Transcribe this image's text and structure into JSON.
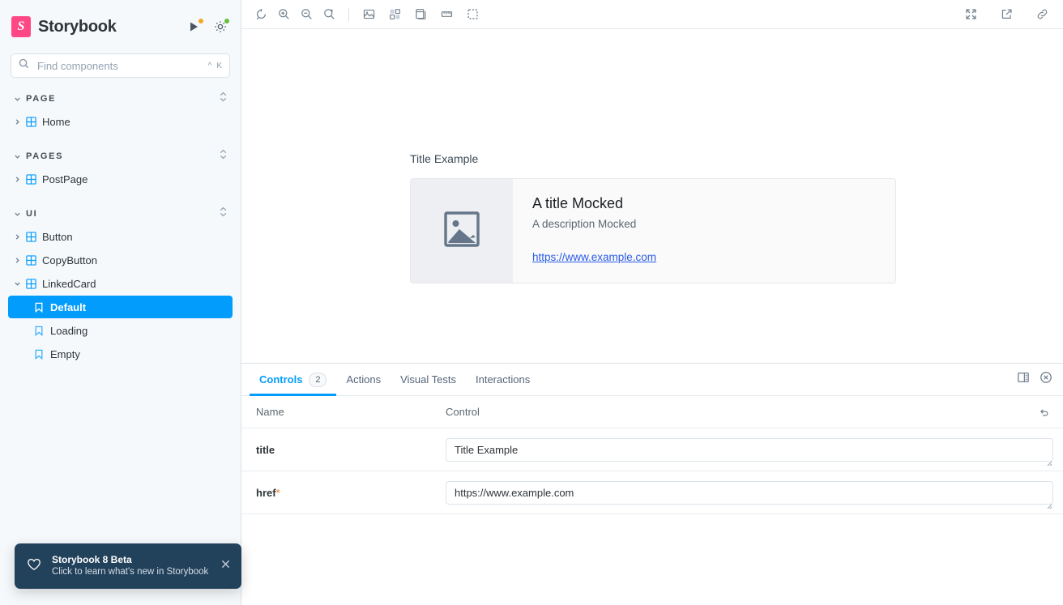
{
  "sidebar": {
    "brand": "Storybook",
    "logo_glyph": "S",
    "brand_color": "#FF4785",
    "header_icons": [
      {
        "name": "whats-new-icon",
        "dot": "orange"
      },
      {
        "name": "settings-gear-icon",
        "dot": "green"
      }
    ],
    "search": {
      "placeholder": "Find components",
      "value": "",
      "shortcut_modifier": "^",
      "shortcut_key": "K"
    },
    "sections": [
      {
        "title": "PAGE",
        "items": [
          {
            "label": "Home",
            "type": "component",
            "expanded": false,
            "selected": false
          }
        ]
      },
      {
        "title": "PAGES",
        "items": [
          {
            "label": "PostPage",
            "type": "component",
            "expanded": false,
            "selected": false
          }
        ]
      },
      {
        "title": "UI",
        "items": [
          {
            "label": "Button",
            "type": "component",
            "expanded": false,
            "selected": false
          },
          {
            "label": "CopyButton",
            "type": "component",
            "expanded": false,
            "selected": false
          },
          {
            "label": "LinkedCard",
            "type": "component",
            "expanded": true,
            "selected": false
          },
          {
            "label": "Default",
            "type": "story",
            "selected": true
          },
          {
            "label": "Loading",
            "type": "story",
            "selected": false
          },
          {
            "label": "Empty",
            "type": "story",
            "selected": false
          }
        ]
      }
    ],
    "toast": {
      "title": "Storybook 8 Beta",
      "subtitle": "Click to learn what's new in Storybook",
      "background": "#22415B",
      "icon": "heart-icon",
      "close_icon": "close-icon"
    }
  },
  "toolbar": {
    "left_icons": [
      "remount-icon",
      "zoom-in-icon",
      "zoom-out-icon",
      "zoom-reset-icon"
    ],
    "group_icons": [
      "backgrounds-icon",
      "grid-icon",
      "theme-icon",
      "measure-icon",
      "outline-icon"
    ],
    "right_icons": [
      "fullscreen-icon",
      "open-new-tab-icon",
      "copy-link-icon"
    ]
  },
  "preview": {
    "story_title": "Title Example",
    "card": {
      "title": "A title Mocked",
      "description": "A description Mocked",
      "link": "https://www.example.com",
      "link_color": "#2B5CE6",
      "image_placeholder_icon": "image-placeholder-icon"
    }
  },
  "panel": {
    "tabs": [
      {
        "label": "Controls",
        "badge": "2",
        "active": true
      },
      {
        "label": "Actions",
        "badge": null,
        "active": false
      },
      {
        "label": "Visual Tests",
        "badge": null,
        "active": false
      },
      {
        "label": "Interactions",
        "badge": null,
        "active": false
      }
    ],
    "active_color": "#029CFD",
    "actions": [
      {
        "name": "panel-position-icon"
      },
      {
        "name": "close-panel-icon"
      }
    ],
    "table": {
      "headers": {
        "name": "Name",
        "control": "Control"
      },
      "reset_icon": "reset-controls-icon",
      "rows": [
        {
          "name": "title",
          "required": false,
          "value": "Title Example",
          "control_type": "textarea"
        },
        {
          "name": "href",
          "required": true,
          "required_mark": "*",
          "value": "https://www.example.com",
          "control_type": "textarea"
        }
      ]
    }
  }
}
